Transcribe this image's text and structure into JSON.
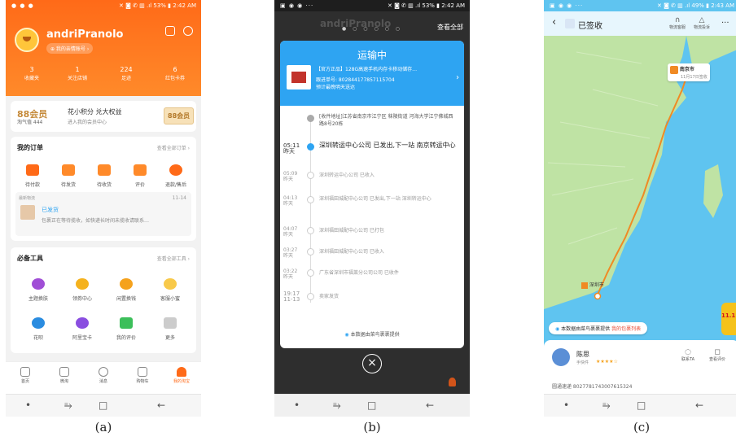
{
  "captions": [
    "(a)",
    "(b)",
    "(c)"
  ],
  "status_bar": {
    "a": {
      "left": "● ● ●",
      "right": "✕ ◙ ✆ ▥ .ıl 53% ▮ 2:42 AM"
    },
    "b": {
      "left": "▣ ◉ ◉ ···",
      "right": "✕ ◙ ✆ ▥ .ıl 53% ▮ 2:42 AM"
    },
    "c": {
      "left": "▣ ◉ ◉ ···",
      "right": "✕ ◙ ✆ ▥ .ıl 49% ▮ 2:43 AM"
    }
  },
  "android_nav": {
    "dot": "•",
    "recent": "⥱",
    "home": "□",
    "back": "←"
  },
  "panel_a": {
    "username": "andriPranolo",
    "account_pill": "⊕ 我的亲情账号 ›",
    "stats": [
      {
        "value": "3",
        "label": "收藏夹"
      },
      {
        "value": "1",
        "label": "关注店铺"
      },
      {
        "value": "224",
        "label": "足迹"
      },
      {
        "value": "6",
        "label": "红包卡券"
      }
    ],
    "vip": {
      "logo": "88会员",
      "sub": "淘气值 444",
      "title": "花小积分 兑大权益",
      "desc": "进入我的会员中心",
      "badge": "88会员"
    },
    "orders": {
      "title": "我的订单",
      "link": "查看全部订单 ›",
      "items": [
        "待付款",
        "待发货",
        "待收货",
        "评价",
        "退款/售后"
      ],
      "logistics_label": "最新物流",
      "logistics_date": "11-14",
      "logistics_status": "已发货",
      "logistics_desc": "包裹正在等待揽收，如快递长时间未揽收请联系…"
    },
    "tools": {
      "title": "必备工具",
      "link": "查看全部工具 ›",
      "items": [
        "主题换肤",
        "领券中心",
        "闲置换钱",
        "客服小蜜",
        "花呗",
        "阿里宝卡",
        "我的评价",
        "更多"
      ]
    },
    "tabs": [
      "首页",
      "微淘",
      "消息",
      "购物车",
      "我的淘宝"
    ]
  },
  "panel_b": {
    "header_name": "andriPranolo",
    "view_all": "查看全部",
    "modal_title": "运输中",
    "product": "【官方正品】128G高速手机内存卡移动储存…",
    "tracking": "跟进单号: 802844177857115704",
    "carrier_line": "预计最晚明天送达",
    "address": "[收件地址]江苏省南京市江宁区 秣陵街道 河海大学江宁佛城西路8号20栋",
    "events": [
      {
        "time": "05:11",
        "day": "昨天",
        "text": "深圳转运中心公司 已发出,下一站 南京转运中心"
      },
      {
        "time": "05:09",
        "day": "昨天",
        "text": "深圳转运中心公司 已收入"
      },
      {
        "time": "04:13",
        "day": "昨天",
        "text": "深圳福田城配中心公司 已发出,下一站 深圳转运中心"
      },
      {
        "time": "04:07",
        "day": "昨天",
        "text": "深圳福田城配中心公司 已打包"
      },
      {
        "time": "03:27",
        "day": "昨天",
        "text": "深圳福田城配中心公司 已收入"
      },
      {
        "time": "03:22",
        "day": "昨天",
        "text": "广东省深圳市福莱分公司公司 已收件"
      },
      {
        "time": "19:17",
        "day": "11-13",
        "text": "卖家发货"
      }
    ],
    "source_text": "本数据由菜鸟裹裹提供",
    "close_symbol": "×"
  },
  "panel_c": {
    "title": "已签收",
    "top_actions": [
      "物流客服",
      "物流投诉"
    ],
    "more": "···",
    "dest_city": "南京市",
    "dest_sub": "11月17日签收",
    "origin_city": "深圳市",
    "source_text": "本数据由菜鸟裹裹提供",
    "source_link": "我的包裹列表",
    "courier_name": "陈思",
    "courier_role": "手快件",
    "courier_rating": "★★★★☆",
    "courier_actions": [
      "联系TA",
      "查看评价"
    ],
    "tracking": "圆通速递 8027781743007615324",
    "promo": "11.11"
  },
  "colors": {
    "taobao_orange": "#ff6a18",
    "cainiao_blue": "#2ea4f2",
    "route_orange": "#f08a24",
    "sea_blue": "#5fc4f0",
    "land_green": "#bfe3a4"
  }
}
